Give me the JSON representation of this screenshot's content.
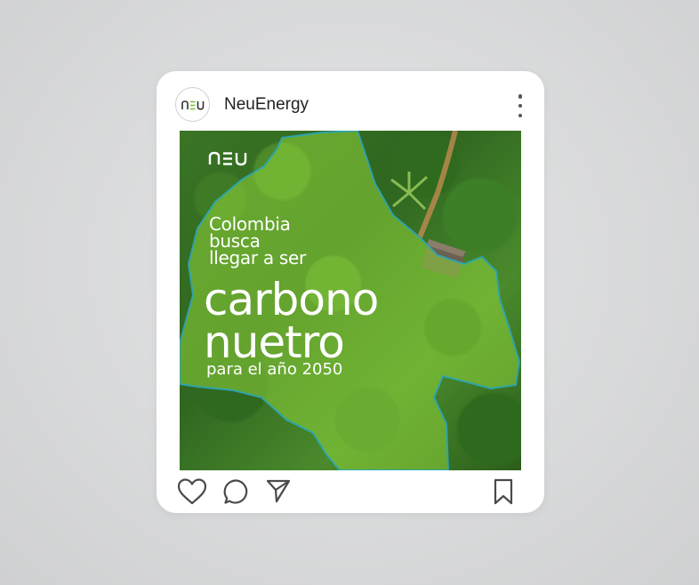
{
  "post": {
    "account_name": "NeuEnergy",
    "avatar_logo": "neu",
    "image_logo": "neu",
    "headline_lines": [
      "Colombia",
      "busca",
      "llegar a ser"
    ],
    "big_lines": [
      "carbono",
      "nuetro"
    ],
    "subline": "para el año 2050"
  },
  "icons": {
    "more": "more-vertical-icon",
    "like": "heart-icon",
    "comment": "comment-icon",
    "share": "send-icon",
    "save": "bookmark-icon"
  },
  "colors": {
    "card_bg": "#ffffff",
    "overlay_green": "#8fd63a",
    "outline_blue": "#2aa6b8",
    "logo_accent": "#7cc242"
  }
}
